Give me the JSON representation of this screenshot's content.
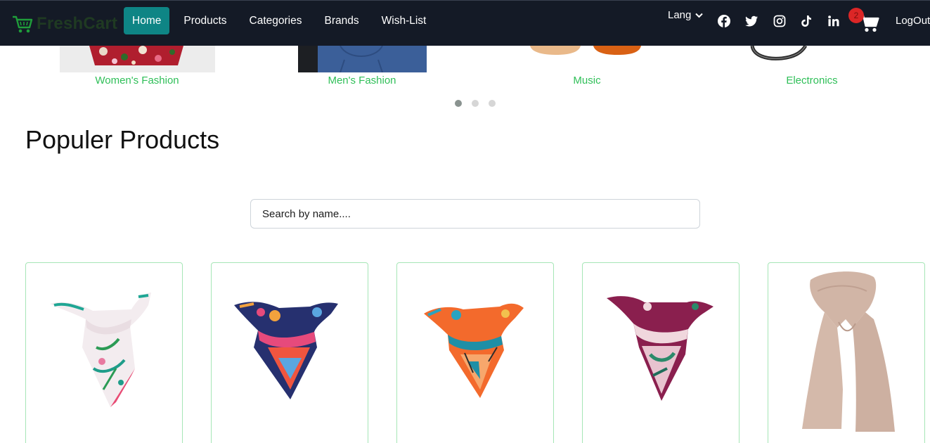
{
  "brand": {
    "name": "FreshCart",
    "icon": "cart-logo-icon",
    "color": "#1f3a22"
  },
  "nav": {
    "links": [
      {
        "label": "Home",
        "active": true
      },
      {
        "label": "Products",
        "active": false
      },
      {
        "label": "Categories",
        "active": false
      },
      {
        "label": "Brands",
        "active": false
      },
      {
        "label": "Wish-List",
        "active": false
      }
    ],
    "lang_label": "Lang",
    "social_icons": [
      "facebook-icon",
      "twitter-icon",
      "instagram-icon",
      "tiktok-icon",
      "linkedin-icon"
    ],
    "cart_count": "2",
    "logout_label": "LogOut",
    "accent": "#0e8585"
  },
  "categories": [
    {
      "label": "Women's Fashion"
    },
    {
      "label": "Men's Fashion"
    },
    {
      "label": "Music"
    },
    {
      "label": "Electronics"
    }
  ],
  "slider": {
    "pages": 3,
    "active_page": 1
  },
  "section_title": "Populer Products",
  "search": {
    "placeholder": "Search by name....",
    "value": ""
  },
  "products": [
    {
      "image": "floral-white-scarf"
    },
    {
      "image": "navy-pink-scarf"
    },
    {
      "image": "orange-teal-scarf"
    },
    {
      "image": "burgundy-floral-scarf"
    },
    {
      "image": "beige-long-scarf"
    }
  ]
}
